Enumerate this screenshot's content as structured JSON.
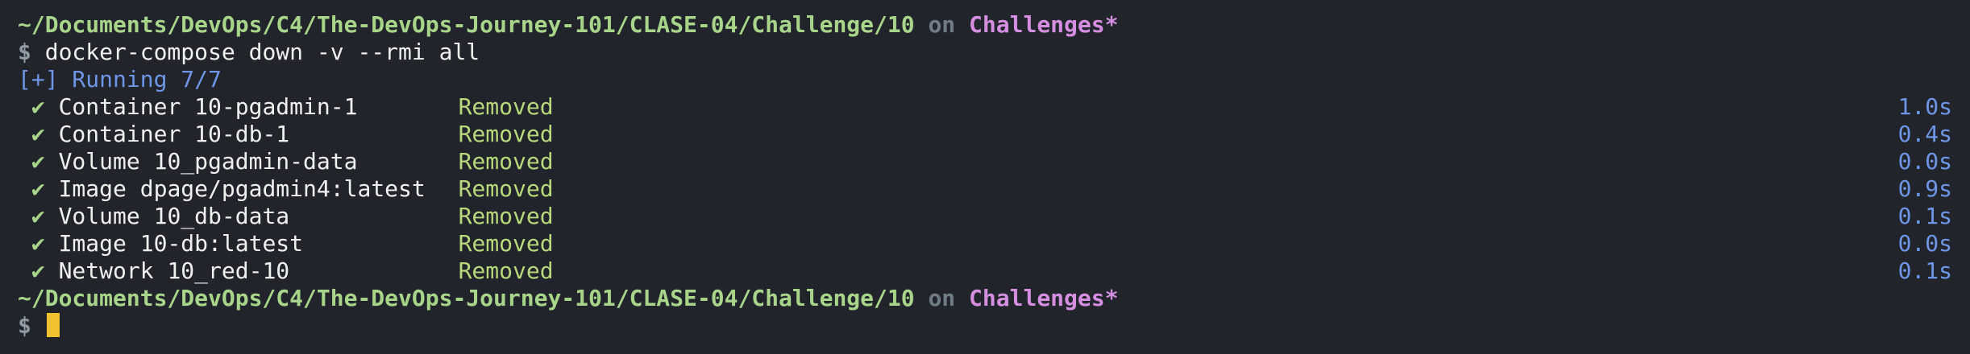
{
  "prompt": {
    "path": "~/Documents/DevOps/C4/The-DevOps-Journey-101/CLASE-04/Challenge/10",
    "on": "on",
    "branch": "Challenges*",
    "symbol": "$"
  },
  "command": "docker-compose down -v --rmi all",
  "running": "[+] Running 7/7",
  "check_glyph": "✔",
  "resources": [
    {
      "name": "Container 10-pgadmin-1",
      "status": "Removed",
      "time": "1.0s"
    },
    {
      "name": "Container 10-db-1",
      "status": "Removed",
      "time": "0.4s"
    },
    {
      "name": "Volume 10_pgadmin-data",
      "status": "Removed",
      "time": "0.0s"
    },
    {
      "name": "Image dpage/pgadmin4:latest",
      "status": "Removed",
      "time": "0.9s"
    },
    {
      "name": "Volume 10_db-data",
      "status": "Removed",
      "time": "0.1s"
    },
    {
      "name": "Image 10-db:latest",
      "status": "Removed",
      "time": "0.0s"
    },
    {
      "name": "Network 10_red-10",
      "status": "Removed",
      "time": "0.1s"
    }
  ],
  "colors": {
    "background": "#21252b",
    "path": "#a8d58a",
    "branch": "#d58ee0",
    "running": "#6f95e6",
    "cursor": "#f2c230"
  }
}
